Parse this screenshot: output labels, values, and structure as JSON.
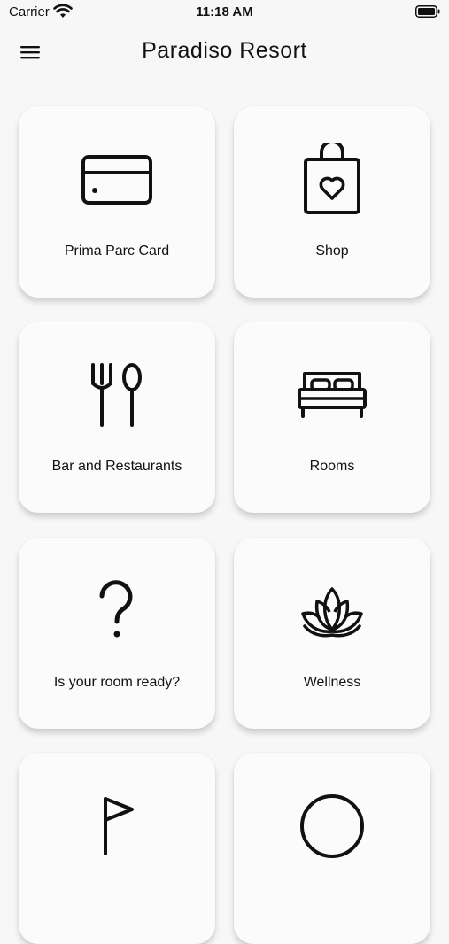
{
  "status_bar": {
    "carrier": "Carrier",
    "time": "11:18 AM"
  },
  "header": {
    "title": "Paradiso Resort",
    "menu_icon": "hamburger-menu-icon"
  },
  "tiles": [
    {
      "label": "Prima Parc Card",
      "icon": "credit-card-icon"
    },
    {
      "label": "Shop",
      "icon": "shopping-bag-heart-icon"
    },
    {
      "label": "Bar and Restaurants",
      "icon": "fork-spoon-icon"
    },
    {
      "label": "Rooms",
      "icon": "bed-icon"
    },
    {
      "label": "Is your room ready?",
      "icon": "question-mark-icon"
    },
    {
      "label": "Wellness",
      "icon": "lotus-icon"
    },
    {
      "label": "",
      "icon": "flag-icon"
    },
    {
      "label": "",
      "icon": "circle-icon"
    }
  ],
  "colors": {
    "background": "#f7f7f7",
    "tile": "#fbfbfb",
    "text": "#111111"
  }
}
